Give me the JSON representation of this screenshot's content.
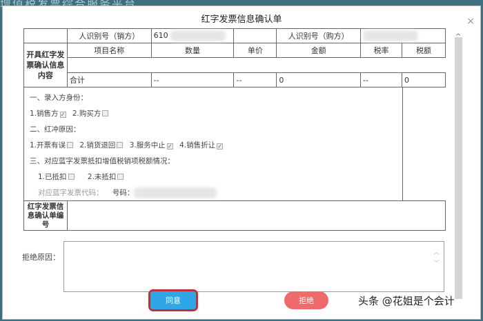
{
  "background_title": "增值税发票综合服务平台",
  "dialog": {
    "title": "红字发票信息确认单",
    "close": "×"
  },
  "table": {
    "seller_id_label": "人识别号（销方）",
    "seller_id_value": "610",
    "buyer_id_label": "人识别号（购方）",
    "section_label": "开具红字发票确认信息内容",
    "headers": [
      "项目名称",
      "数量",
      "单价",
      "金额",
      "税率",
      "税额"
    ],
    "total_row": [
      "合计",
      "--",
      "--",
      "0",
      "--",
      "0"
    ]
  },
  "options": {
    "s1": "一、录入方身份：",
    "s1_items": [
      "1.销售方",
      "2.购买方"
    ],
    "s2": "二、红冲原因：",
    "s2_items": [
      "1.开票有误",
      "2.销货退回",
      "3.服务中止",
      "4.销售折让"
    ],
    "s3": "三、对应蓝字发票抵扣增值税销项税额情况：",
    "s3_items": [
      "1.已抵扣",
      "2.未抵扣"
    ],
    "code_label": "对应蓝字发票代码：",
    "number_label": "号码："
  },
  "confirm_no_label": "红字发票信息确认单编号",
  "reject_reason_label": "拒绝原因：",
  "buttons": {
    "agree": "同意",
    "reject": "拒绝"
  },
  "watermark": "头条 @花姐是个会计"
}
